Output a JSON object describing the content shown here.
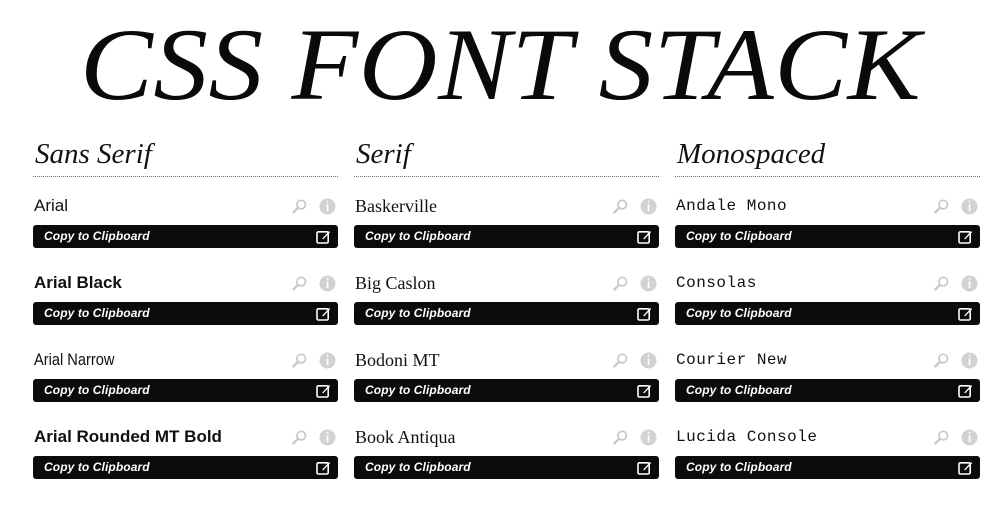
{
  "page": {
    "title": "CSS FONT STACK",
    "background_color": "#ffffff",
    "text_color": "#000000",
    "bar_color": "#0b0b0b",
    "icon_color": "#cccccc"
  },
  "columns": [
    {
      "header": "Sans Serif",
      "style_class": "sans",
      "fonts": [
        {
          "name": "Arial",
          "weight": "normal",
          "variant": ""
        },
        {
          "name": "Arial Black",
          "weight": "bold",
          "variant": ""
        },
        {
          "name": "Arial Narrow",
          "weight": "normal",
          "variant": "narrow"
        },
        {
          "name": "Arial Rounded MT Bold",
          "weight": "bold",
          "variant": ""
        }
      ]
    },
    {
      "header": "Serif",
      "style_class": "serif",
      "fonts": [
        {
          "name": "Baskerville",
          "weight": "normal",
          "variant": ""
        },
        {
          "name": "Big Caslon",
          "weight": "normal",
          "variant": ""
        },
        {
          "name": "Bodoni MT",
          "weight": "normal",
          "variant": ""
        },
        {
          "name": "Book Antiqua",
          "weight": "normal",
          "variant": ""
        }
      ]
    },
    {
      "header": "Monospaced",
      "style_class": "mono",
      "fonts": [
        {
          "name": "Andale Mono",
          "weight": "normal",
          "variant": ""
        },
        {
          "name": "Consolas",
          "weight": "normal",
          "variant": ""
        },
        {
          "name": "Courier New",
          "weight": "normal",
          "variant": ""
        },
        {
          "name": "Lucida Console",
          "weight": "normal",
          "variant": ""
        }
      ]
    }
  ],
  "row_controls": {
    "copy_label": "Copy to Clipboard",
    "preview_icon": "search-icon",
    "info_icon": "info-icon",
    "copy_icon": "copy-to-clipboard-icon"
  }
}
